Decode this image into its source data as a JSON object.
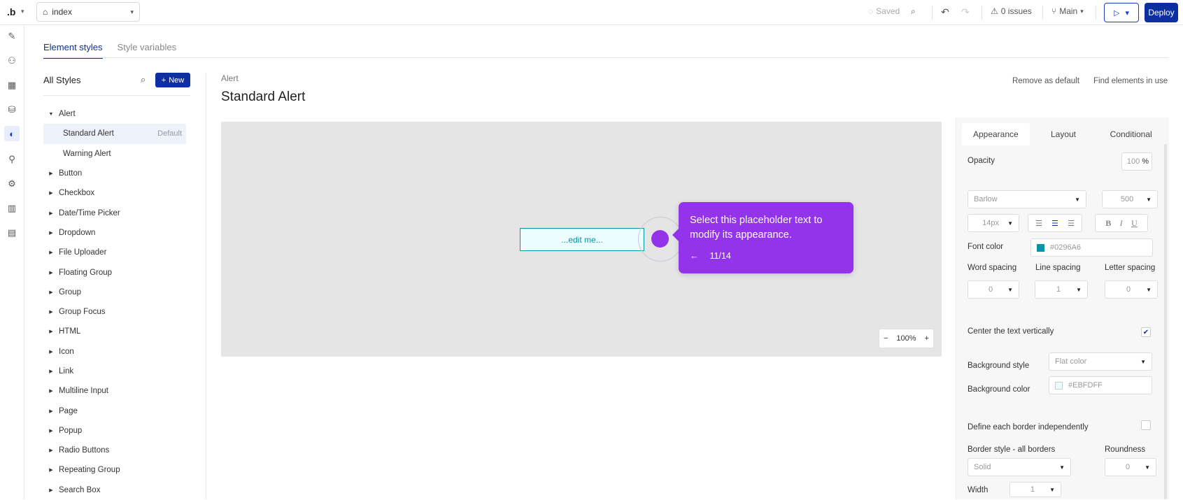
{
  "topbar": {
    "logo": ".b",
    "page_name": "index",
    "saved": "Saved",
    "issues": "0 issues",
    "branch": "Main",
    "deploy": "Deploy"
  },
  "tabs": [
    {
      "label": "Element styles",
      "active": true
    },
    {
      "label": "Style variables",
      "active": false
    }
  ],
  "styles_panel": {
    "title": "All Styles",
    "new_label": "New",
    "tree": [
      {
        "label": "Alert",
        "expanded": true
      },
      {
        "label": "Standard Alert",
        "child": true,
        "selected": true,
        "badge": "Default"
      },
      {
        "label": "Warning Alert",
        "child": true
      },
      {
        "label": "Button"
      },
      {
        "label": "Checkbox"
      },
      {
        "label": "Date/Time Picker"
      },
      {
        "label": "Dropdown"
      },
      {
        "label": "File Uploader"
      },
      {
        "label": "Floating Group"
      },
      {
        "label": "Group"
      },
      {
        "label": "Group Focus"
      },
      {
        "label": "HTML"
      },
      {
        "label": "Icon"
      },
      {
        "label": "Link"
      },
      {
        "label": "Multiline Input"
      },
      {
        "label": "Page"
      },
      {
        "label": "Popup"
      },
      {
        "label": "Radio Buttons"
      },
      {
        "label": "Repeating Group"
      },
      {
        "label": "Search Box"
      }
    ]
  },
  "main": {
    "breadcrumb": "Alert",
    "title": "Standard Alert",
    "remove_default": "Remove as default",
    "find_elements": "Find elements in use",
    "preview_text": "...edit me...",
    "zoom": "100%"
  },
  "tooltip": {
    "text": "Select this placeholder text to modify its appearance.",
    "progress": "11/14"
  },
  "props": {
    "tabs": [
      {
        "label": "Appearance",
        "active": true
      },
      {
        "label": "Layout",
        "active": false
      },
      {
        "label": "Conditional",
        "active": false
      }
    ],
    "opacity_label": "Opacity",
    "opacity_value": "100",
    "opacity_unit": "%",
    "font_family": "Barlow",
    "font_weight": "500",
    "font_size": "14px",
    "font_color_label": "Font color",
    "font_color": "#0296A6",
    "word_spacing_label": "Word spacing",
    "line_spacing_label": "Line spacing",
    "letter_spacing_label": "Letter spacing",
    "word_spacing": "0",
    "line_spacing": "1",
    "letter_spacing": "0",
    "center_vertically_label": "Center the text vertically",
    "center_vertically": true,
    "bg_style_label": "Background style",
    "bg_style": "Flat color",
    "bg_color_label": "Background color",
    "bg_color": "#EBFDFF",
    "border_independent_label": "Define each border independently",
    "border_style_label": "Border style - all borders",
    "border_style": "Solid",
    "roundness_label": "Roundness",
    "roundness": "0",
    "width_label": "Width",
    "width": "1"
  },
  "colors": {
    "brand": "#0d2f9f",
    "tooltip": "#9333ea",
    "alert_text": "#0296a6",
    "alert_bg": "#ebfdff"
  }
}
